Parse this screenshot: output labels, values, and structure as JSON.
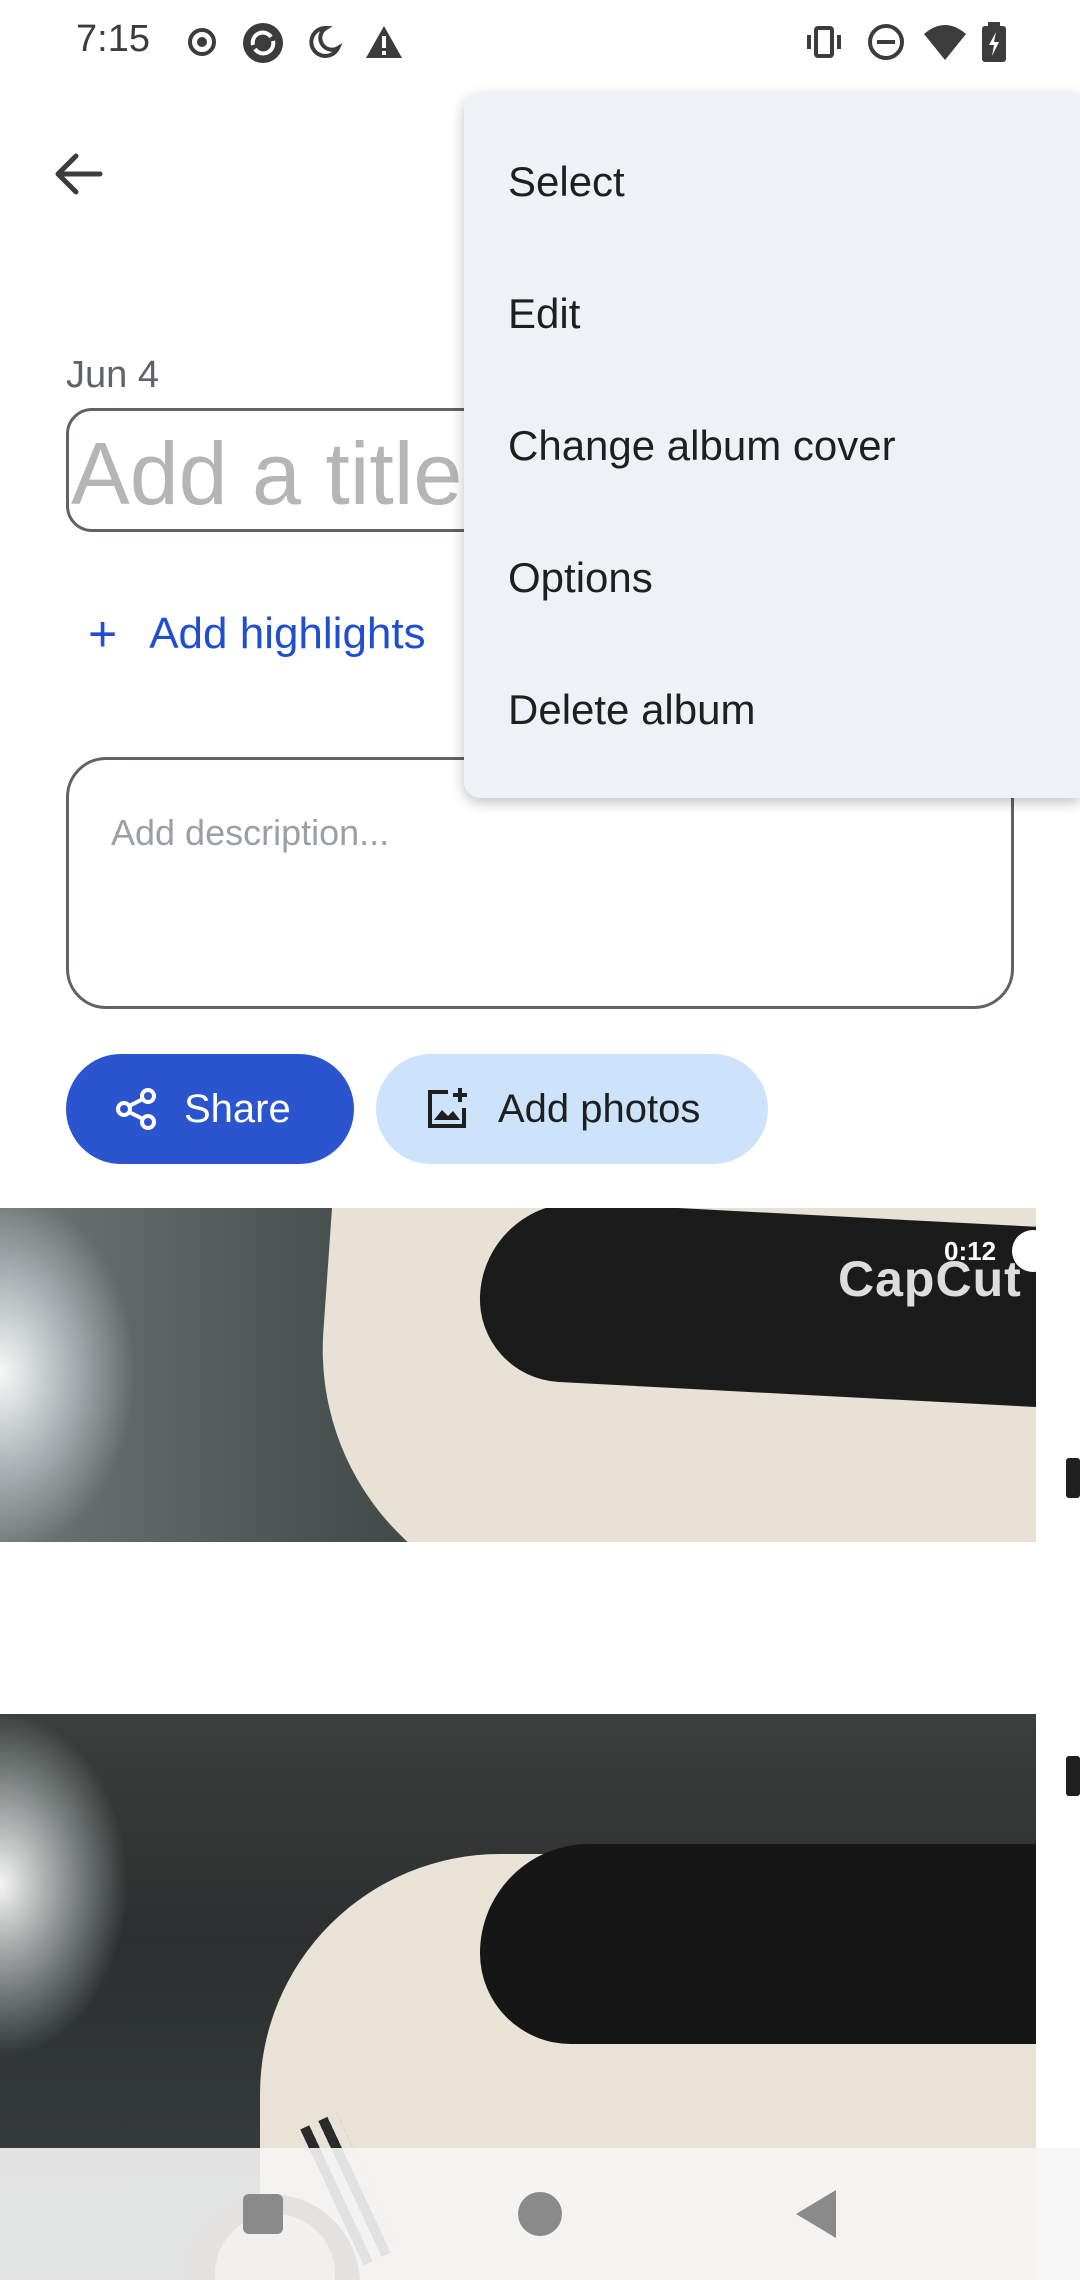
{
  "status_bar": {
    "time": "7:15",
    "left_icons": [
      "record-icon",
      "sync-icon",
      "night-mode-icon",
      "warning-icon"
    ],
    "right_icons": [
      "vibrate-icon",
      "do-not-disturb-icon",
      "wifi-icon",
      "battery-icon"
    ]
  },
  "album": {
    "date": "Jun 4",
    "title_placeholder": "Add a title",
    "add_highlights": "Add highlights",
    "description_placeholder": "Add description...",
    "share_label": "Share",
    "add_photos_label": "Add photos"
  },
  "photos": [
    {
      "type": "video",
      "duration": "0:12",
      "watermark": "CapCut"
    },
    {
      "type": "photo"
    }
  ],
  "menu": {
    "items": [
      "Select",
      "Edit",
      "Change album cover",
      "Options",
      "Delete album"
    ]
  },
  "colors": {
    "accent": "#2a55cf",
    "accent_light": "#cde3fb",
    "menu_bg": "#eef1f6",
    "highlight_text": "#1f4fcf"
  }
}
